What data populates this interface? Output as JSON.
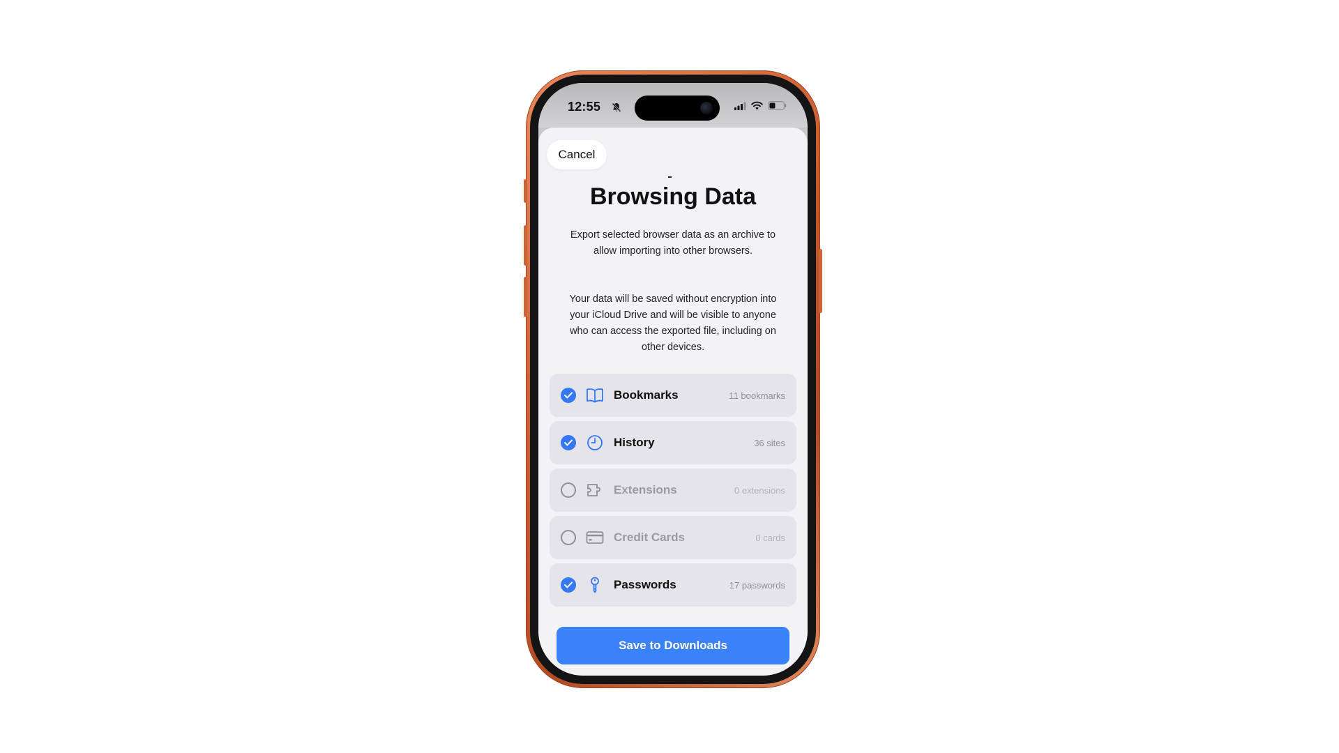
{
  "status_bar": {
    "time": "12:55"
  },
  "sheet": {
    "cancel_label": "Cancel",
    "title": "Browsing Data",
    "description_1": "Export selected browser data as an archive to allow importing into other browsers.",
    "description_2": "Your data will be saved without encryption into your iCloud Drive and will be visible to anyone who can access the exported file, including on other devices.",
    "options": [
      {
        "label": "Bookmarks",
        "count": "11 bookmarks",
        "selected": true,
        "icon": "book-icon"
      },
      {
        "label": "History",
        "count": "36 sites",
        "selected": true,
        "icon": "clock-icon"
      },
      {
        "label": "Extensions",
        "count": "0 extensions",
        "selected": false,
        "icon": "puzzle-icon"
      },
      {
        "label": "Credit Cards",
        "count": "0 cards",
        "selected": false,
        "icon": "credit-card-icon"
      },
      {
        "label": "Passwords",
        "count": "17 passwords",
        "selected": true,
        "icon": "key-icon"
      }
    ],
    "save_label": "Save to Downloads"
  },
  "colors": {
    "accent": "#3478f6",
    "phone_frame": "#c8592c",
    "sheet_background": "#f2f2f7",
    "row_background": "#e4e4ea"
  }
}
